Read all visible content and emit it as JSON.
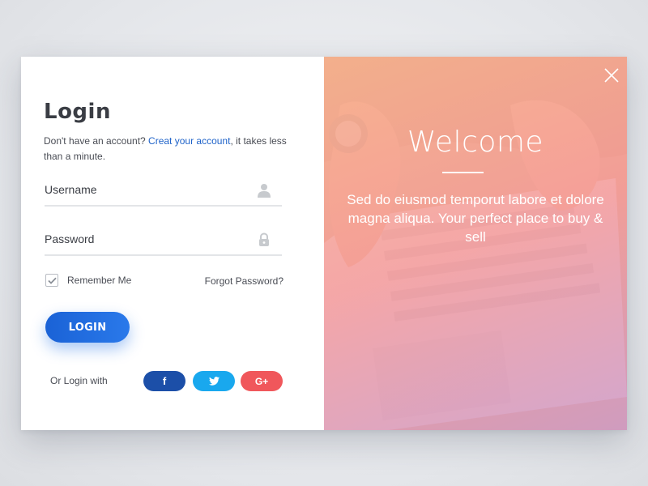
{
  "login": {
    "title": "Login",
    "subtitle_prefix": "Don't have an account? ",
    "create_link": "Creat your account",
    "subtitle_suffix": ", it takes less than a minute.",
    "username_placeholder": "Username",
    "password_placeholder": "Password",
    "remember_label": "Remember Me",
    "remember_checked": true,
    "forgot_label": "Forgot Password?",
    "login_button": "LOGIN",
    "social_label": "Or Login with",
    "social": [
      {
        "name": "facebook",
        "glyph": "f",
        "color": "#1c4fa8"
      },
      {
        "name": "twitter",
        "glyph": "twitter-bird-icon",
        "color": "#19a8ee"
      },
      {
        "name": "google-plus",
        "glyph": "G+",
        "color": "#f0575b"
      }
    ]
  },
  "welcome": {
    "heading": "Welcome",
    "tagline": "Sed do eiusmod temporut labore et dolore magna aliqua. Your perfect place to buy & sell"
  },
  "colors": {
    "accent": "#1a62d6",
    "link": "#1f63c9",
    "text": "#3a3d44",
    "overlay_top": "#fcb28c",
    "overlay_bottom": "#cd96c8"
  },
  "icons": [
    "user-icon",
    "lock-icon",
    "check-icon",
    "close-icon",
    "facebook-icon",
    "twitter-icon",
    "google-plus-icon"
  ]
}
